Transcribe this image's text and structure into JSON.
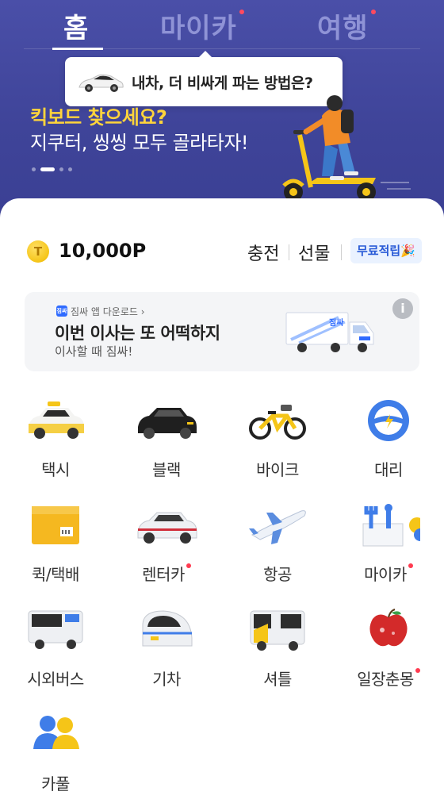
{
  "header": {
    "tabs": [
      {
        "label": "홈",
        "active": true,
        "badge": false
      },
      {
        "label": "마이카",
        "active": false,
        "badge": true
      },
      {
        "label": "여행",
        "active": false,
        "badge": true
      }
    ],
    "tooltip": "내차, 더 비싸게 파는 방법은?"
  },
  "banner": {
    "title": "킥보드 찾으세요?",
    "subtitle": "지쿠터, 씽씽 모두 골라타자!",
    "page_index": 2,
    "page_count": 4
  },
  "points": {
    "coin_letter": "T",
    "value": "10,000P",
    "charge_label": "충전",
    "gift_label": "선물",
    "free_label": "무료적립🎉"
  },
  "ad": {
    "brand_icon": "짐싸",
    "brand": "짐싸 앱 다운로드 ›",
    "title": "이번 이사는 또 어떡하지",
    "subtitle": "이사할 때 짐싸!",
    "info": "i",
    "truck_text": "짐싸"
  },
  "services": [
    {
      "label": "택시",
      "icon": "taxi-icon",
      "badge": false
    },
    {
      "label": "블랙",
      "icon": "black-car-icon",
      "badge": false
    },
    {
      "label": "바이크",
      "icon": "bike-icon",
      "badge": false
    },
    {
      "label": "대리",
      "icon": "steering-wheel-icon",
      "badge": false
    },
    {
      "label": "퀵/택배",
      "icon": "box-icon",
      "badge": false
    },
    {
      "label": "렌터카",
      "icon": "rental-car-icon",
      "badge": true
    },
    {
      "label": "항공",
      "icon": "airplane-icon",
      "badge": false
    },
    {
      "label": "마이카",
      "icon": "tools-icon",
      "badge": true
    },
    {
      "label": "시외버스",
      "icon": "bus-icon",
      "badge": false
    },
    {
      "label": "기차",
      "icon": "train-icon",
      "badge": false
    },
    {
      "label": "셔틀",
      "icon": "shuttle-icon",
      "badge": false
    },
    {
      "label": "일장춘몽",
      "icon": "apple-icon",
      "badge": true
    },
    {
      "label": "카풀",
      "icon": "carpool-icon",
      "badge": false
    }
  ],
  "colors": {
    "header_bg": "#3f4499",
    "accent_yellow": "#ffd43b",
    "badge_red": "#ff3b50",
    "link_blue": "#2a5bd7"
  }
}
